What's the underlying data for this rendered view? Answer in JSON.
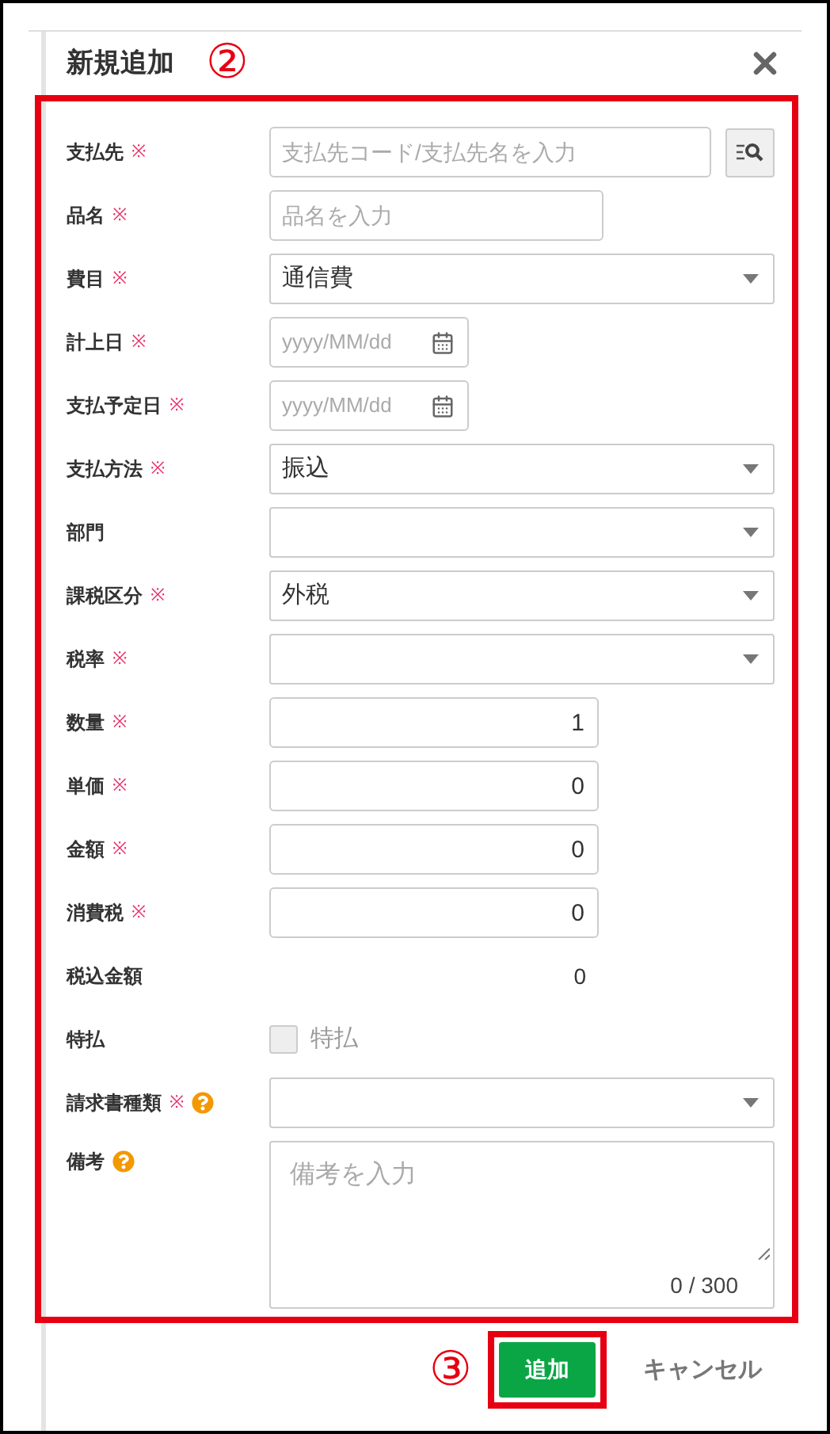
{
  "dialog": {
    "title": "新規追加",
    "annotation": "②"
  },
  "form": {
    "highlighted": true,
    "fields": [
      {
        "label": "支払先",
        "mark": "※",
        "help": false,
        "kind": "search",
        "placeholder": "支払先コード/支払先名を入力"
      },
      {
        "label": "品名",
        "mark": "※",
        "help": false,
        "kind": "text",
        "placeholder": "品名を入力"
      },
      {
        "label": "費目",
        "mark": "※",
        "help": false,
        "kind": "select",
        "value": "通信費"
      },
      {
        "label": "計上日",
        "mark": "※",
        "help": false,
        "kind": "date",
        "placeholder": "yyyy/MM/dd"
      },
      {
        "label": "支払予定日",
        "mark": "※",
        "help": false,
        "kind": "date",
        "placeholder": "yyyy/MM/dd"
      },
      {
        "label": "支払方法",
        "mark": "※",
        "help": false,
        "kind": "select",
        "value": "振込"
      },
      {
        "label": "部門",
        "help": false,
        "kind": "select"
      },
      {
        "label": "課税区分",
        "mark": "※",
        "help": false,
        "kind": "select",
        "value": "外税"
      },
      {
        "label": "税率",
        "mark": "※",
        "help": false,
        "kind": "select"
      },
      {
        "label": "数量",
        "mark": "※",
        "help": false,
        "kind": "number",
        "value": "1"
      },
      {
        "label": "単価",
        "mark": "※",
        "help": false,
        "kind": "number",
        "value": "0"
      },
      {
        "label": "金額",
        "mark": "※",
        "help": false,
        "kind": "number",
        "value": "0"
      },
      {
        "label": "消費税",
        "mark": "※",
        "help": false,
        "kind": "number",
        "value": "0"
      },
      {
        "label": "税込金額",
        "help": false,
        "kind": "readonly",
        "value": "0"
      },
      {
        "label": "特払",
        "help": false,
        "kind": "checkbox",
        "option": "特払",
        "checked": false,
        "disabled": true
      },
      {
        "label": "請求書種類",
        "mark": "※",
        "help": true,
        "kind": "select"
      },
      {
        "label": "備考",
        "help": true,
        "kind": "textarea",
        "placeholder": "備考を入力",
        "counter": "0 / 300"
      }
    ]
  },
  "footer": {
    "annotation": "③",
    "buttons": [
      {
        "label": "追加",
        "kind": "primary",
        "highlighted": true
      },
      {
        "label": "キャンセル",
        "kind": "link",
        "highlighted": false
      }
    ]
  }
}
